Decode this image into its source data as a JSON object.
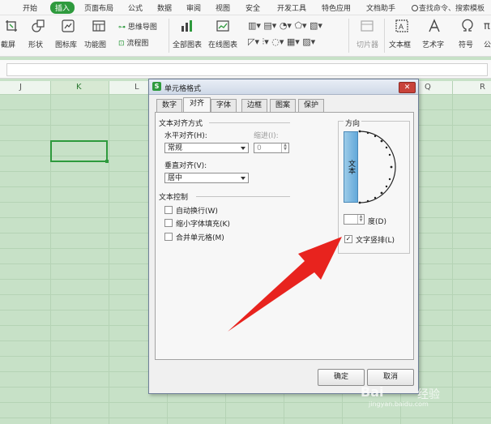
{
  "menu": {
    "items": [
      "开始",
      "插入",
      "页面布局",
      "公式",
      "数据",
      "审阅",
      "视图",
      "安全",
      "开发工具",
      "特色应用",
      "文档助手"
    ],
    "active_index": 1,
    "search_text": "查找命令、搜索模板"
  },
  "ribbon": {
    "screenshot": "截屏",
    "shapes": "形状",
    "icon_library": "图标库",
    "function_chart": "功能图",
    "mind_map": "思维导图",
    "flowchart": "流程图",
    "all_charts": "全部图表",
    "online_charts": "在线图表",
    "slicer": "切片器",
    "textbox": "文本框",
    "wordart": "艺术字",
    "symbol": "符号",
    "formula": "公式"
  },
  "sheet": {
    "columns": [
      "J",
      "K",
      "L",
      "Q",
      "R"
    ],
    "accent": "#2e9a3d"
  },
  "dialog": {
    "title": "单元格格式",
    "tabs": [
      "数字",
      "对齐",
      "字体",
      "边框",
      "图案",
      "保护"
    ],
    "active_tab": "对齐",
    "section_text_align": "文本对齐方式",
    "h_align_label": "水平对齐(H):",
    "h_align_value": "常规",
    "indent_label": "缩进(I):",
    "indent_value": "0",
    "v_align_label": "垂直对齐(V):",
    "v_align_value": "居中",
    "section_text_control": "文本控制",
    "wrap_text": "自动换行(W)",
    "shrink_to_fit": "缩小字体填充(K)",
    "merge_cells": "合并单元格(M)",
    "orientation_title": "方向",
    "vertical_text_button": "文本",
    "degree_label": "度(D)",
    "vertical_text_checkbox": "文字竖排(L)",
    "vertical_text_checked": true,
    "ok": "确定",
    "cancel": "取消"
  },
  "watermark": {
    "site": "jingyan.baidu.com",
    "brand": "经验"
  }
}
